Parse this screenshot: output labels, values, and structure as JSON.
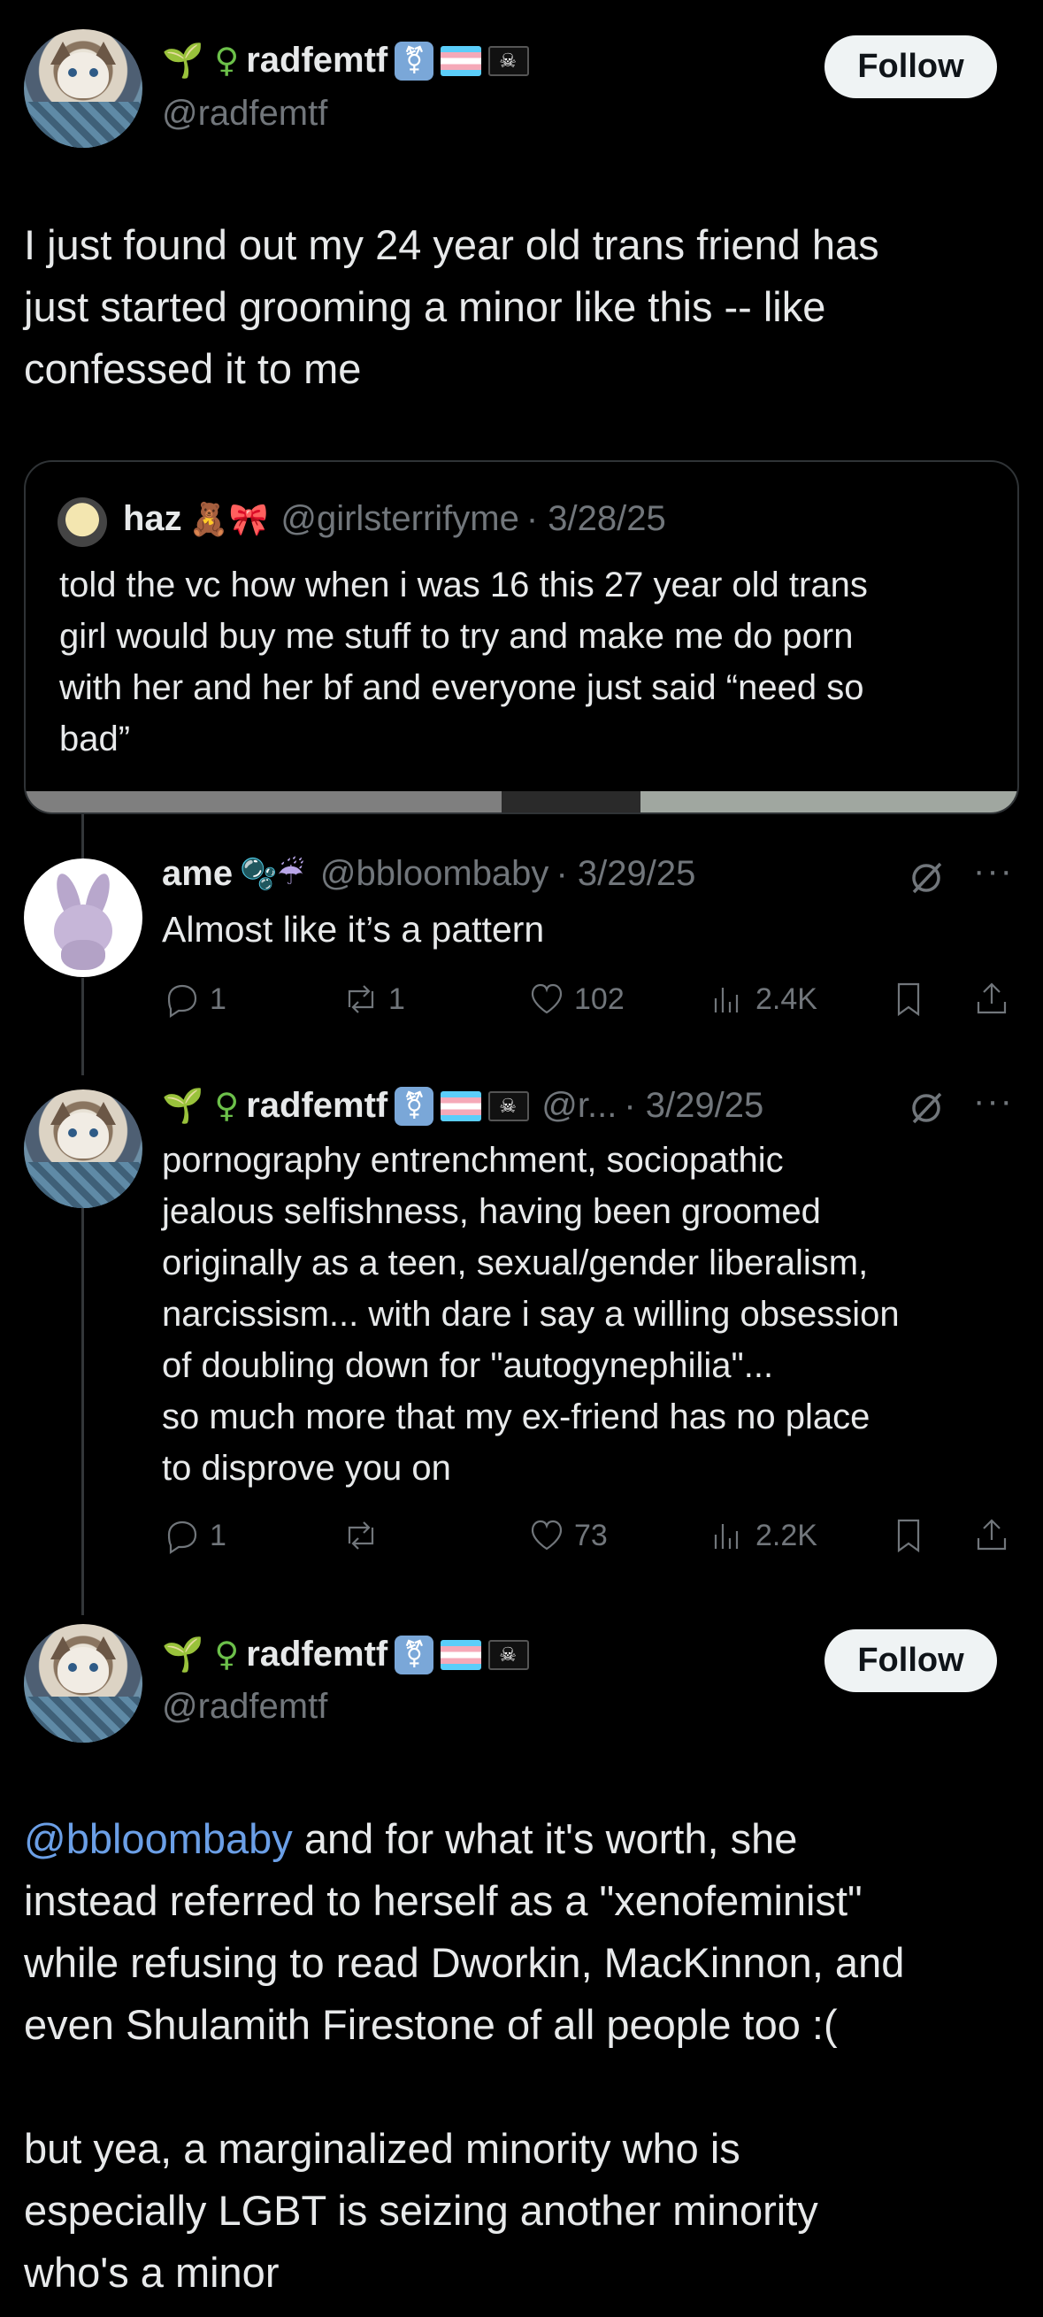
{
  "main_post": {
    "display_name": "radfemtf",
    "display_prefix": "🌱 ♀",
    "handle": "@radfemtf",
    "follow_label": "Follow",
    "text": "I just found out my 24 year old trans friend has\njust started grooming a minor like this -- like\nconfessed it to me"
  },
  "quoted_post": {
    "display_name": "haz",
    "emojis": "🧸🎀",
    "handle": "@girlsterrifyme",
    "date": "· 3/28/25",
    "text": "told the vc how when i was 16 this 27 year old trans\ngirl would buy me stuff to try and make me do porn\nwith her and her bf and everyone just said “need so\nbad”"
  },
  "reply1": {
    "display_name": "ame",
    "emojis": "🫧☔",
    "handle": "@bbloombaby",
    "date": "· 3/29/25",
    "text": "Almost like it’s a pattern",
    "replies": "1",
    "reposts": "1",
    "likes": "102",
    "views": "2.4K"
  },
  "reply2": {
    "display_prefix": "🌱 ♀",
    "display_name": "radfemtf",
    "handle": "@r...",
    "date": "· 3/29/25",
    "text": "pornography entrenchment, sociopathic\njealous selfishness, having been groomed\noriginally as a teen, sexual/gender liberalism,\nnarcissism... with dare i say a willing obsession\nof doubling down for \"autogynephilia\"...\nso much more that my ex-friend has no place\nto disprove you on",
    "replies": "1",
    "reposts": "",
    "likes": "73",
    "views": "2.2K"
  },
  "focused_post": {
    "display_prefix": "🌱 ♀",
    "display_name": "radfemtf",
    "handle": "@radfemtf",
    "follow_label": "Follow",
    "mention": "@bbloombaby",
    "text_after_mention": " and for what it's worth, she\ninstead referred to herself as a \"xenofeminist\"\nwhile refusing to read Dworkin, MacKinnon, and\neven Shulamith Firestone of all people too :(\n\nbut yea, a marginalized minority who is\nespecially LGBT is seizing another minority\nwho's a minor"
  },
  "icons": {
    "reply": "reply-icon",
    "repost": "repost-icon",
    "like": "heart-icon",
    "views": "views-icon",
    "bookmark": "bookmark-icon",
    "share": "share-icon",
    "grok": "grok-icon",
    "more": "more-icon"
  },
  "colors": {
    "background": "#000000",
    "text": "#e7e9ea",
    "secondary": "#71767b",
    "mention": "#6b9fe6",
    "follow_bg": "#eff3f4"
  }
}
